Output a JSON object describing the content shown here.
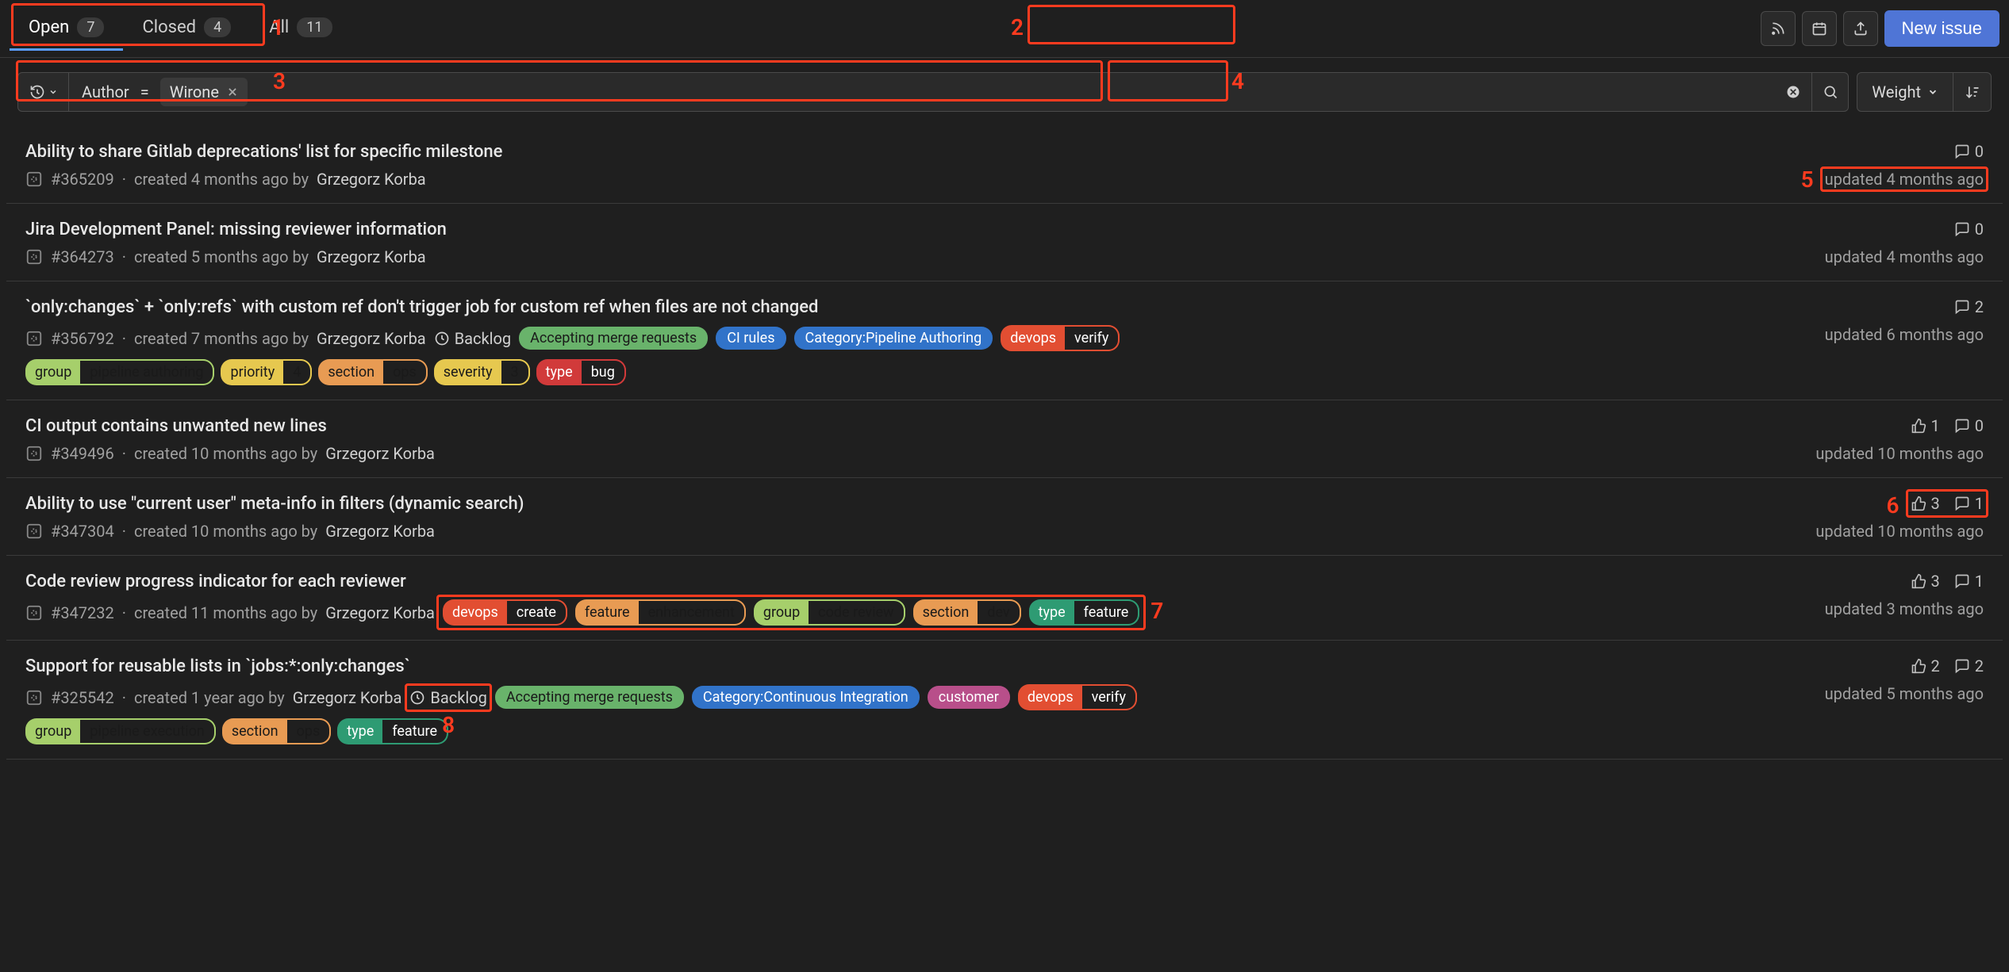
{
  "tabs": {
    "open": {
      "label": "Open",
      "count": "7"
    },
    "closed": {
      "label": "Closed",
      "count": "4"
    },
    "all": {
      "label": "All",
      "count": "11"
    }
  },
  "header": {
    "new_issue": "New issue"
  },
  "filter": {
    "field": "Author",
    "op": "=",
    "value": "Wirone"
  },
  "sort": {
    "label": "Weight"
  },
  "issues": [
    {
      "title": "Ability to share Gitlab deprecations' list for specific milestone",
      "ref": "#365209",
      "created": "created 4 months ago by",
      "author": "Grzegorz Korba",
      "comments": "0",
      "updated": "updated 4 months ago"
    },
    {
      "title": "Jira Development Panel: missing reviewer information",
      "ref": "#364273",
      "created": "created 5 months ago by",
      "author": "Grzegorz Korba",
      "comments": "0",
      "updated": "updated 4 months ago"
    },
    {
      "title": "`only:changes` + `only:refs` with custom ref don't trigger job for custom ref when files are not changed",
      "ref": "#356792",
      "created": "created 7 months ago by",
      "author": "Grzegorz Korba",
      "milestone": "Backlog",
      "comments": "2",
      "updated": "updated 6 months ago",
      "labels1": [
        {
          "text": "Accepting merge requests",
          "bg": "#69b36b",
          "fg": "#1a1a1a"
        },
        {
          "text": "CI rules",
          "bg": "#3173c9",
          "fg": "#ffffff"
        },
        {
          "text": "Category:Pipeline Authoring",
          "bg": "#3173c9",
          "fg": "#ffffff"
        },
        {
          "scope": "devops",
          "value": "verify",
          "bg": "#e24e32",
          "fg": "#ffffff"
        }
      ],
      "labels2": [
        {
          "scope": "group",
          "value": "pipeline authoring",
          "bg": "#a6cf6b",
          "fg": "#1a1a1a"
        },
        {
          "scope": "priority",
          "value": "4",
          "bg": "#e6c84f",
          "fg": "#1a1a1a"
        },
        {
          "scope": "section",
          "value": "ops",
          "bg": "#e89b53",
          "fg": "#1a1a1a"
        },
        {
          "scope": "severity",
          "value": "3",
          "bg": "#e6c84f",
          "fg": "#1a1a1a"
        },
        {
          "scope": "type",
          "value": "bug",
          "bg": "#d13a3a",
          "fg": "#ffffff"
        }
      ]
    },
    {
      "title": "CI output contains unwanted new lines",
      "ref": "#349496",
      "created": "created 10 months ago by",
      "author": "Grzegorz Korba",
      "thumbs": "1",
      "comments": "0",
      "updated": "updated 10 months ago"
    },
    {
      "title": "Ability to use \"current user\" meta-info in filters (dynamic search)",
      "ref": "#347304",
      "created": "created 10 months ago by",
      "author": "Grzegorz Korba",
      "thumbs": "3",
      "comments": "1",
      "updated": "updated 10 months ago"
    },
    {
      "title": "Code review progress indicator for each reviewer",
      "ref": "#347232",
      "created": "created 11 months ago by",
      "author": "Grzegorz Korba",
      "thumbs": "3",
      "comments": "1",
      "updated": "updated 3 months ago",
      "labels1": [
        {
          "scope": "devops",
          "value": "create",
          "bg": "#e24e32",
          "fg": "#ffffff"
        },
        {
          "scope": "feature",
          "value": "enhancement",
          "bg": "#e89b53",
          "fg": "#1a1a1a"
        },
        {
          "scope": "group",
          "value": "code review",
          "bg": "#a6cf6b",
          "fg": "#1a1a1a"
        },
        {
          "scope": "section",
          "value": "dev",
          "bg": "#e89b53",
          "fg": "#1a1a1a"
        },
        {
          "scope": "type",
          "value": "feature",
          "bg": "#2e9b73",
          "fg": "#ffffff"
        }
      ]
    },
    {
      "title": "Support for reusable lists in `jobs:*:only:changes`",
      "ref": "#325542",
      "created": "created 1 year ago by",
      "author": "Grzegorz Korba",
      "milestone": "Backlog",
      "thumbs": "2",
      "comments": "2",
      "updated": "updated 5 months ago",
      "labels1": [
        {
          "text": "Accepting merge requests",
          "bg": "#69b36b",
          "fg": "#1a1a1a"
        },
        {
          "text": "Category:Continuous Integration",
          "bg": "#3173c9",
          "fg": "#ffffff"
        },
        {
          "text": "customer",
          "bg": "#b84f8a",
          "fg": "#ffffff"
        },
        {
          "scope": "devops",
          "value": "verify",
          "bg": "#e24e32",
          "fg": "#ffffff"
        }
      ],
      "labels2": [
        {
          "scope": "group",
          "value": "pipeline execution",
          "bg": "#a6cf6b",
          "fg": "#1a1a1a"
        },
        {
          "scope": "section",
          "value": "ops",
          "bg": "#e89b53",
          "fg": "#1a1a1a"
        },
        {
          "scope": "type",
          "value": "feature",
          "bg": "#2e9b73",
          "fg": "#ffffff"
        }
      ]
    }
  ],
  "ann": [
    "1",
    "2",
    "3",
    "4",
    "5",
    "6",
    "7",
    "8"
  ]
}
